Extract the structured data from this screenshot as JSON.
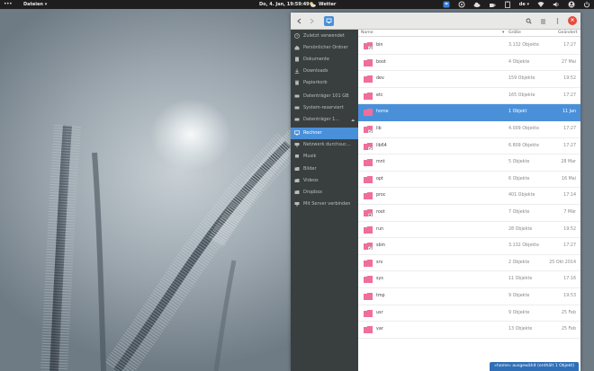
{
  "topbar": {
    "app_menu": "Dateien ▾",
    "clock": "Do, 4. Jan, 19:59:49",
    "weather": "Wetter",
    "keyboard": "de ▾"
  },
  "window": {
    "close_label": "×"
  },
  "sidebar": {
    "items": [
      {
        "label": "Zuletzt verwendet",
        "icon": "clock-icon"
      },
      {
        "label": "Persönlicher Ordner",
        "icon": "home-icon"
      },
      {
        "label": "Dokumente",
        "icon": "document-icon"
      },
      {
        "label": "Downloads",
        "icon": "download-icon"
      },
      {
        "label": "Papierkorb",
        "icon": "trash-icon"
      },
      {
        "label": "Datenträger 101 GB",
        "icon": "drive-icon"
      },
      {
        "label": "System-reserviert",
        "icon": "drive-icon"
      },
      {
        "label": "Datenträger 1...",
        "icon": "drive-icon"
      },
      {
        "label": "Rechner",
        "icon": "computer-icon",
        "active": true
      },
      {
        "label": "Netzwerk durchsuc...",
        "icon": "network-icon"
      },
      {
        "label": "Musik",
        "icon": "music-icon"
      },
      {
        "label": "Bilder",
        "icon": "pictures-icon"
      },
      {
        "label": "Videos",
        "icon": "videos-icon"
      },
      {
        "label": "Dropbox",
        "icon": "folder-icon"
      },
      {
        "label": "Mit Server verbinden",
        "icon": "network-icon"
      }
    ]
  },
  "columns": {
    "name": "Name",
    "size": "Größe",
    "modified": "Geändert"
  },
  "files": [
    {
      "name": "bin",
      "size": "3.132 Objekte",
      "date": "17:27",
      "link": true
    },
    {
      "name": "boot",
      "size": "4 Objekte",
      "date": "27 Mai",
      "link": false
    },
    {
      "name": "dev",
      "size": "159 Objekte",
      "date": "19:52",
      "link": false
    },
    {
      "name": "etc",
      "size": "165 Objekte",
      "date": "17:27",
      "link": false
    },
    {
      "name": "home",
      "size": "1 Objekt",
      "date": "11 Jan",
      "link": false,
      "selected": true
    },
    {
      "name": "lib",
      "size": "4.009 Objekte",
      "date": "17:27",
      "link": true
    },
    {
      "name": "lib64",
      "size": "6.809 Objekte",
      "date": "17:27",
      "link": true
    },
    {
      "name": "mnt",
      "size": "5 Objekte",
      "date": "28 Mar",
      "link": false
    },
    {
      "name": "opt",
      "size": "6 Objekte",
      "date": "16 Mai",
      "link": false
    },
    {
      "name": "proc",
      "size": "401 Objekte",
      "date": "17:14",
      "link": false
    },
    {
      "name": "root",
      "size": "7 Objekte",
      "date": "7 Mär",
      "link": false,
      "locked": true
    },
    {
      "name": "run",
      "size": "28 Objekte",
      "date": "19:52",
      "link": false
    },
    {
      "name": "sbin",
      "size": "3.132 Objekte",
      "date": "17:27",
      "link": true
    },
    {
      "name": "srv",
      "size": "2 Objekte",
      "date": "25 Okt 2014",
      "link": false
    },
    {
      "name": "sys",
      "size": "11 Objekte",
      "date": "17:16",
      "link": false
    },
    {
      "name": "tmp",
      "size": "9 Objekte",
      "date": "19:53",
      "link": false
    },
    {
      "name": "usr",
      "size": "9 Objekte",
      "date": "25 Feb",
      "link": false
    },
    {
      "name": "var",
      "size": "13 Objekte",
      "date": "25 Feb",
      "link": false
    }
  ],
  "status": "»home« ausgewählt (enthält 1 Objekt)",
  "colors": {
    "accent": "#4a90d9",
    "folder": "#ef6f9a",
    "sidebar": "#393f3f",
    "close": "#e74c3c"
  }
}
